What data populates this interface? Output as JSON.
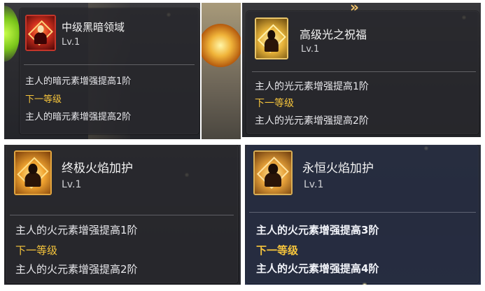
{
  "skill_cards": [
    {
      "name": "中级黑暗领域",
      "level": "Lv.1",
      "current_effect": "主人的暗元素增强提高1阶",
      "next_level_label": "下一等级",
      "next_effect": "主人的暗元素增强提高2阶",
      "icon": "dark-flame-figure-icon",
      "accent_color": "#c4352a"
    },
    {
      "name": "高级光之祝福",
      "level": "Lv.1",
      "current_effect": "主人的光元素增强提高1阶",
      "next_level_label": "下一等级",
      "next_effect": "主人的光元素增强提高2阶",
      "icon": "light-blessing-figure-icon",
      "accent_color": "#e9c56a"
    },
    {
      "name": "终极火焰加护",
      "level": "Lv.1",
      "current_effect": "主人的火元素增强提高1阶",
      "next_level_label": "下一等级",
      "next_effect": "主人的火元素增强提高2阶",
      "icon": "fire-guardian-figure-icon",
      "accent_color": "#e2a540"
    },
    {
      "name": "永恒火焰加护",
      "level": "Lv.1",
      "current_effect": "主人的火元素增强提高3阶",
      "next_level_label": "下一等级",
      "next_effect": "主人的火元素增强提高4阶",
      "icon": "eternal-fire-figure-icon",
      "accent_color": "#d9ae55"
    }
  ],
  "colors": {
    "next_level_text": "#f5c43c",
    "effect_text": "#e8e8ec",
    "title_text": "#f4f4f4"
  }
}
